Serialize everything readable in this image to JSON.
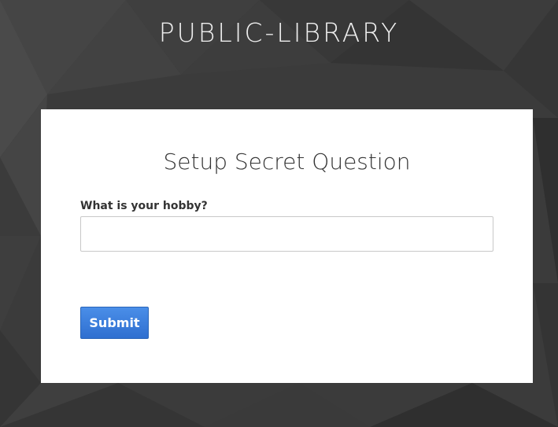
{
  "header": {
    "site_title": "PUBLIC-LIBRARY"
  },
  "form": {
    "title": "Setup Secret Question",
    "question_label": "What is your hobby?",
    "answer_value": "",
    "answer_placeholder": "",
    "submit_label": "Submit"
  },
  "colors": {
    "background": "#3a3a3a",
    "card": "#ffffff",
    "accent": "#3478d8"
  }
}
